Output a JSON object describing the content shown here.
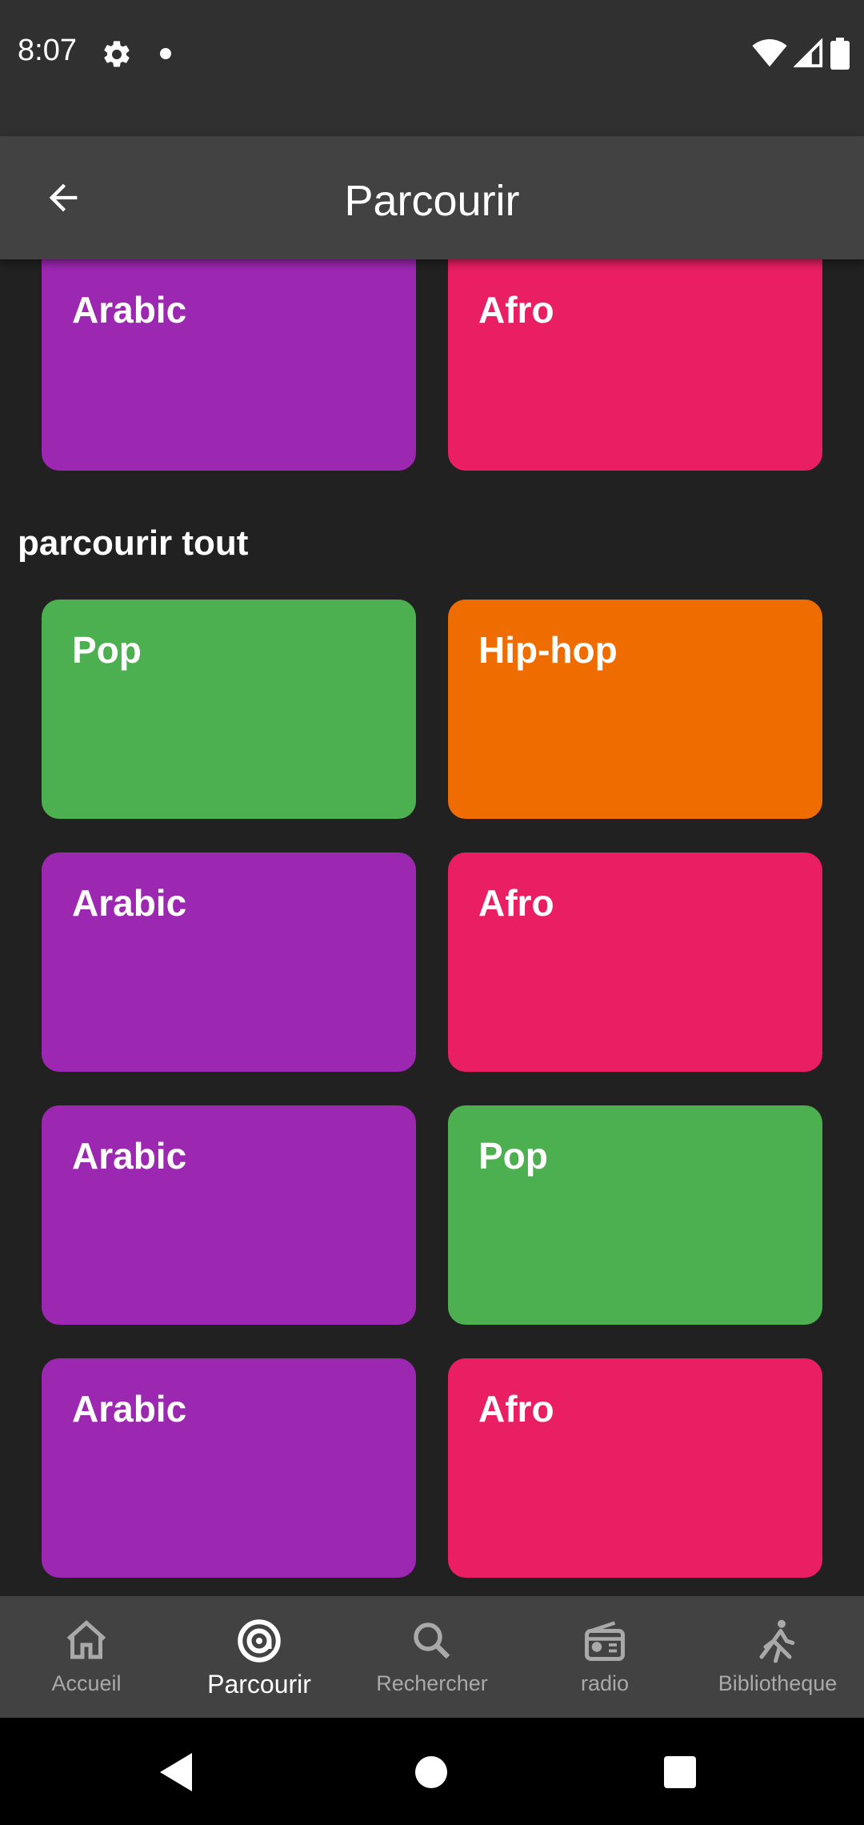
{
  "status_bar": {
    "time": "8:07"
  },
  "app_bar": {
    "title": "Parcourir"
  },
  "featured": [
    {
      "label": "Arabic",
      "color": "#9c27b0"
    },
    {
      "label": "Afro",
      "color": "#e91e63"
    }
  ],
  "section_title": "parcourir tout",
  "genres": [
    {
      "label": "Pop",
      "color": "#4caf50"
    },
    {
      "label": "Hip-hop",
      "color": "#ef6c00"
    },
    {
      "label": "Arabic",
      "color": "#9c27b0"
    },
    {
      "label": "Afro",
      "color": "#e91e63"
    },
    {
      "label": "Arabic",
      "color": "#9c27b0"
    },
    {
      "label": "Pop",
      "color": "#4caf50"
    },
    {
      "label": "Arabic",
      "color": "#9c27b0"
    },
    {
      "label": "Afro",
      "color": "#e91e63"
    }
  ],
  "bottom_nav": {
    "items": [
      {
        "label": "Accueil",
        "icon": "home-icon"
      },
      {
        "label": "Parcourir",
        "icon": "browse-icon",
        "active": true
      },
      {
        "label": "Rechercher",
        "icon": "search-icon"
      },
      {
        "label": "radio",
        "icon": "radio-icon"
      },
      {
        "label": "Bibliotheque",
        "icon": "library-icon"
      }
    ]
  },
  "colors": {
    "background": "#212121",
    "app_bar": "#424242",
    "status_bar": "#303030",
    "nav_inactive": "#a9a9a9",
    "nav_active": "#ffffff"
  }
}
